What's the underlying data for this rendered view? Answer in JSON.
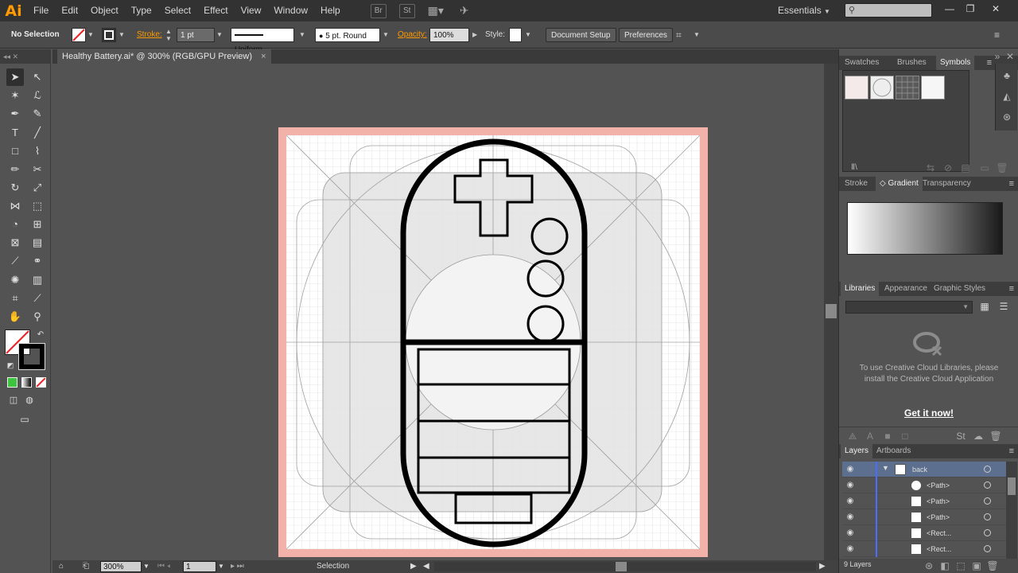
{
  "app": {
    "logo": "Ai"
  },
  "menu": [
    "File",
    "Edit",
    "Object",
    "Type",
    "Select",
    "Effect",
    "View",
    "Window",
    "Help"
  ],
  "menubar_icons": {
    "bridge": "Br",
    "stock": "St"
  },
  "workspace": "Essentials",
  "control_bar": {
    "selection": "No Selection",
    "stroke_label": "Stroke:",
    "stroke_weight": "1 pt",
    "stroke_profile": "Uniform",
    "brush": "5 pt. Round",
    "opacity_label": "Opacity:",
    "opacity_value": "100%",
    "style_label": "Style:",
    "document_setup": "Document Setup",
    "preferences": "Preferences"
  },
  "document": {
    "tab_title": "Healthy Battery.ai* @ 300% (RGB/GPU Preview)",
    "close": "×"
  },
  "status_bar": {
    "zoom": "300%",
    "artboard": "1",
    "tool": "Selection"
  },
  "panels": {
    "top_tabs": [
      "Swatches",
      "Brushes",
      "Symbols"
    ],
    "mid_tabs": [
      "Stroke",
      "Gradient",
      "Transparency"
    ],
    "lib_tabs": [
      "Libraries",
      "Appearance",
      "Graphic Styles"
    ],
    "libraries_message": "To use Creative Cloud Libraries, please install the Creative Cloud Application",
    "libraries_cta": "Get it now!",
    "layers_tabs": [
      "Layers",
      "Artboards"
    ],
    "layers": [
      {
        "name": "back",
        "expanded": true
      },
      {
        "name": "<Path>"
      },
      {
        "name": "<Path>"
      },
      {
        "name": "<Path>"
      },
      {
        "name": "<Rect..."
      },
      {
        "name": "<Rect..."
      }
    ],
    "layers_count": "9 Layers"
  },
  "colors": {
    "accent": "#ff9a00",
    "artboard_bleed": "#f2b2aa",
    "selection_blue": "#4a6cff"
  }
}
